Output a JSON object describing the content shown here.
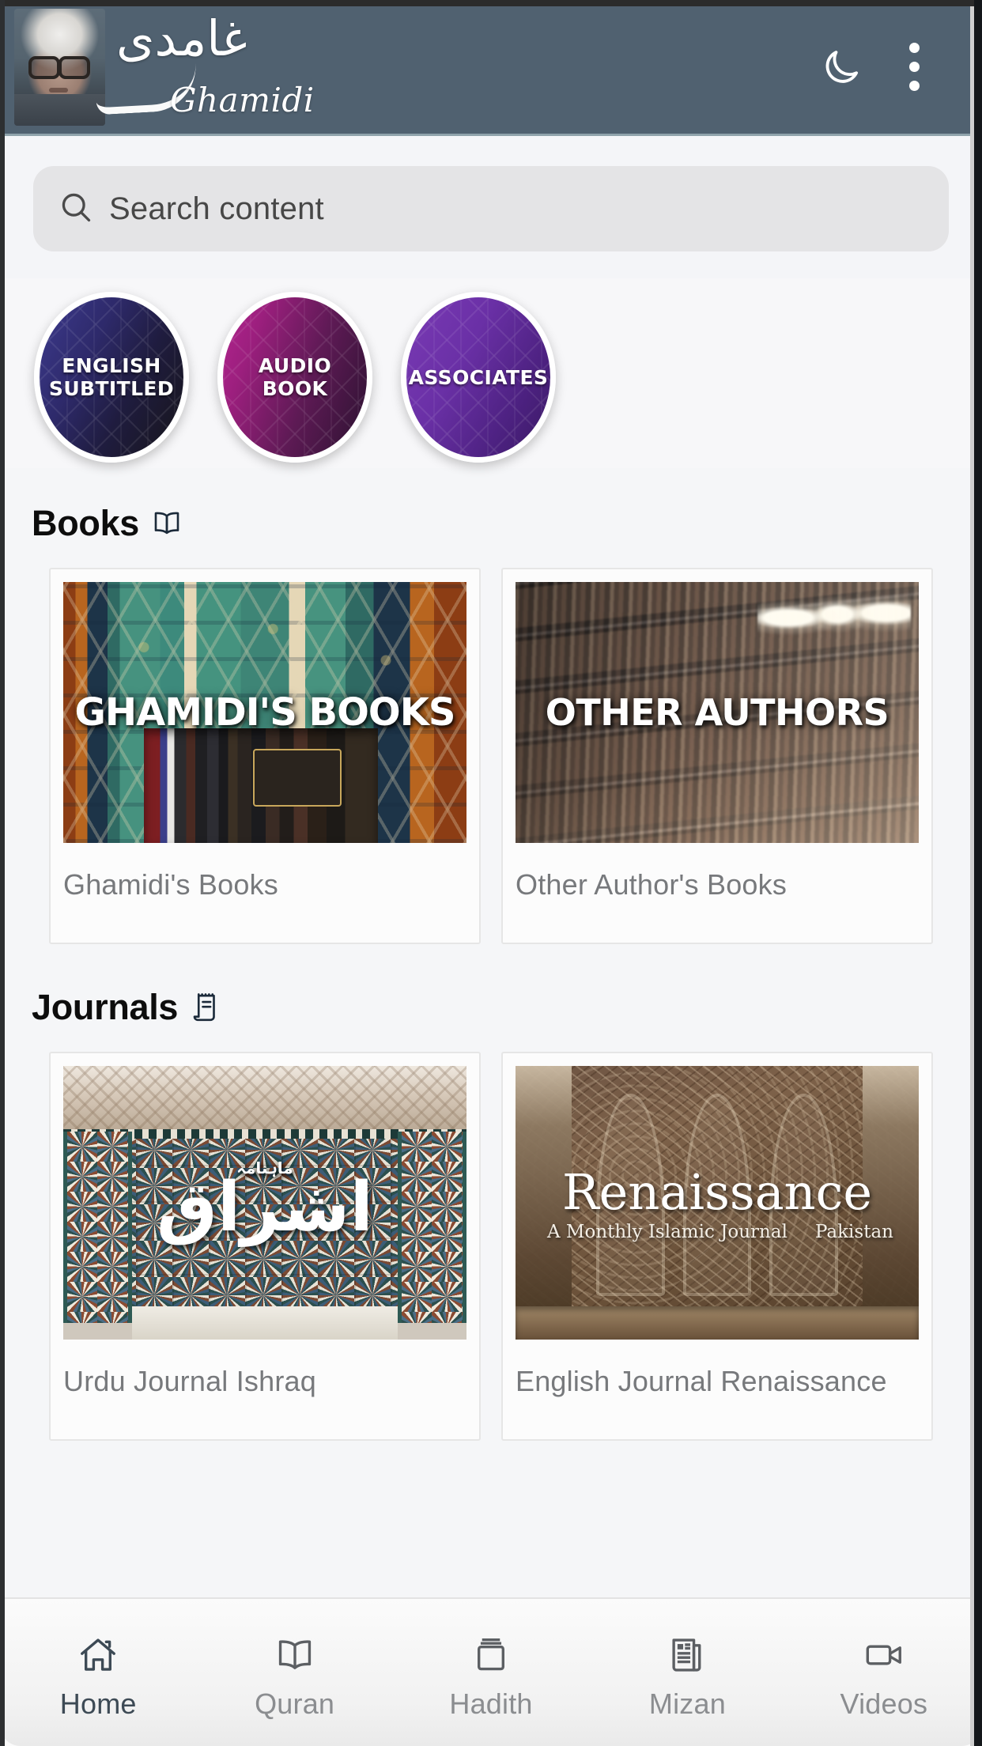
{
  "app": {
    "brand_urdu": "غامدی",
    "brand_latin": "Ghamidi",
    "header_bg": "#506170",
    "page_bg": "#f5f6f8"
  },
  "header": {
    "theme_toggle_icon": "moon-icon",
    "overflow_icon": "three-dots-vertical-icon"
  },
  "search": {
    "icon": "search-icon",
    "placeholder": "Search content",
    "value": ""
  },
  "categories": [
    {
      "label_line1": "ENGLISH",
      "label_line2": "SUBTITLED",
      "color": "#2e2a6b"
    },
    {
      "label_line1": "AUDIO BOOK",
      "label_line2": "",
      "color": "#9c1f7e"
    },
    {
      "label_line1": "ASSOCIATES",
      "label_line2": "",
      "color": "#6a30a6"
    }
  ],
  "sections": [
    {
      "title": "Books",
      "icon": "open-book-icon",
      "cards": [
        {
          "overlay": "GHAMIDI'S BOOKS",
          "caption": "Ghamidi's Books"
        },
        {
          "overlay": "OTHER AUTHORS",
          "caption": "Other Author's Books"
        }
      ]
    },
    {
      "title": "Journals",
      "icon": "receipt-notepad-icon",
      "cards": [
        {
          "overlay": "اشراق",
          "overlay_sub": "ماہنامہ",
          "caption": "Urdu Journal Ishraq"
        },
        {
          "overlay": "Renaissance",
          "overlay_sub": "A Monthly Islamic Journal",
          "overlay_extra": "Pakistan",
          "caption": "English Journal Renaissance"
        }
      ]
    }
  ],
  "bottom_nav": {
    "active_index": 0,
    "active_color": "#3d4a55",
    "inactive_color": "#8b8d90",
    "items": [
      {
        "label": "Home",
        "icon": "home-icon"
      },
      {
        "label": "Quran",
        "icon": "open-book-icon"
      },
      {
        "label": "Hadith",
        "icon": "book-stack-icon"
      },
      {
        "label": "Mizan",
        "icon": "newspaper-icon"
      },
      {
        "label": "Videos",
        "icon": "video-camera-icon"
      }
    ]
  }
}
